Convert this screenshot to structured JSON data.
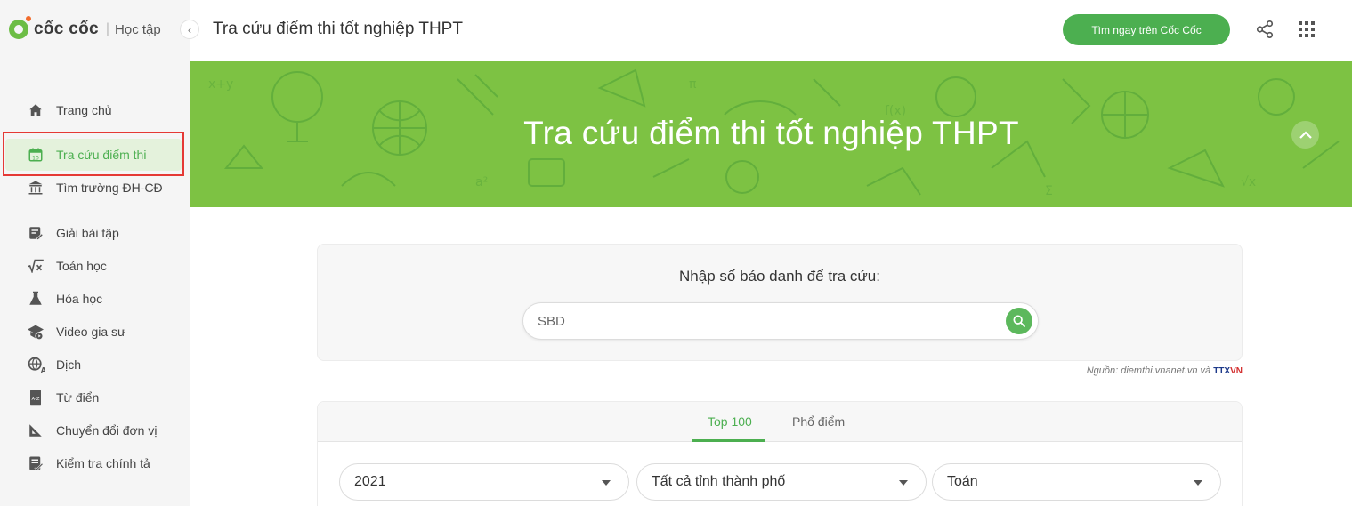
{
  "sidebar": {
    "logo_text": "cốc cốc",
    "logo_separator": "|",
    "logo_sub": "Học tập",
    "collapse_icon": "chevron-left-icon",
    "items": [
      {
        "label": "Trang chủ",
        "icon": "home-icon",
        "active": false
      },
      {
        "label": "Tra cứu điểm thi",
        "icon": "calendar-icon",
        "icon_text": "10",
        "active": true
      },
      {
        "label": "Tìm trường ĐH-CĐ",
        "icon": "school-icon",
        "active": false
      },
      {
        "label": "Giải bài tập",
        "icon": "edit-note-icon",
        "active": false
      },
      {
        "label": "Toán học",
        "icon": "sqrt-x-icon",
        "active": false
      },
      {
        "label": "Hóa học",
        "icon": "flask-icon",
        "active": false
      },
      {
        "label": "Video gia sư",
        "icon": "graduation-cap-icon",
        "active": false
      },
      {
        "label": "Dịch",
        "icon": "translate-icon",
        "active": false
      },
      {
        "label": "Từ điển",
        "icon": "dictionary-icon",
        "active": false
      },
      {
        "label": "Chuyển đổi đơn vị",
        "icon": "ruler-icon",
        "active": false
      },
      {
        "label": "Kiểm tra chính tả",
        "icon": "spellcheck-icon",
        "active": false
      }
    ]
  },
  "header": {
    "title": "Tra cứu điểm thi tốt nghiệp THPT",
    "cta_label": "Tìm ngay trên Cốc Cốc",
    "share_icon": "share-icon",
    "apps_icon": "apps-grid-icon"
  },
  "banner": {
    "title": "Tra cứu điểm thi tốt nghiệp THPT",
    "collapse_icon": "chevron-up-icon"
  },
  "search": {
    "label": "Nhập số báo danh để tra cứu:",
    "placeholder": "SBD",
    "value": "",
    "button_icon": "search-icon"
  },
  "source": {
    "prefix": "Nguồn: diemthi.vnanet.vn và",
    "logo_text": "TTX",
    "logo_suffix": "VN"
  },
  "results": {
    "tabs": [
      {
        "label": "Top 100",
        "active": true
      },
      {
        "label": "Phổ điểm",
        "active": false
      }
    ],
    "filters": {
      "year": "2021",
      "province": "Tất cả tỉnh thành phố",
      "subject": "Toán"
    }
  },
  "colors": {
    "accent": "#4caf50",
    "banner": "#7dc243",
    "highlight_outline": "#e53935"
  }
}
